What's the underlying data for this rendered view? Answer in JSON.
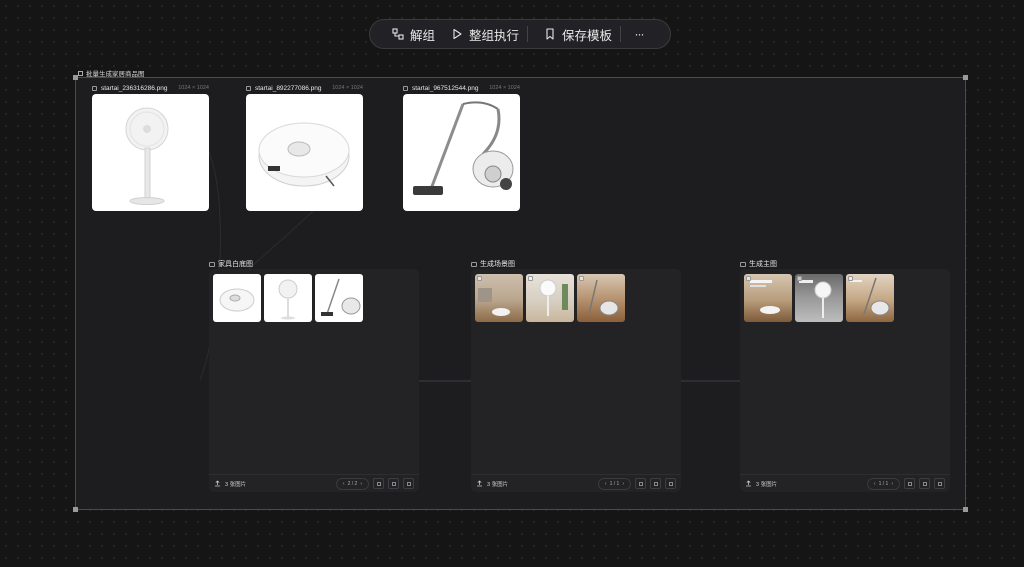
{
  "toolbar": {
    "ungroup": "解组",
    "run_group": "整组执行",
    "save_template": "保存模板",
    "more": "···"
  },
  "group": {
    "title": "批量生成家居商品图"
  },
  "image_nodes": [
    {
      "name": "startai_236316286.png",
      "dim": "1024 × 1024"
    },
    {
      "name": "startai_892277086.png",
      "dim": "1024 × 1024"
    },
    {
      "name": "startai_967512544.png",
      "dim": "1024 × 1024"
    }
  ],
  "panels": [
    {
      "title": "家具白底图",
      "count": "3 张图片",
      "page": "2 / 2"
    },
    {
      "title": "生成场景图",
      "count": "3 张图片",
      "page": "1 / 1"
    },
    {
      "title": "生成主图",
      "count": "3 张图片",
      "page": "1 / 1"
    }
  ]
}
